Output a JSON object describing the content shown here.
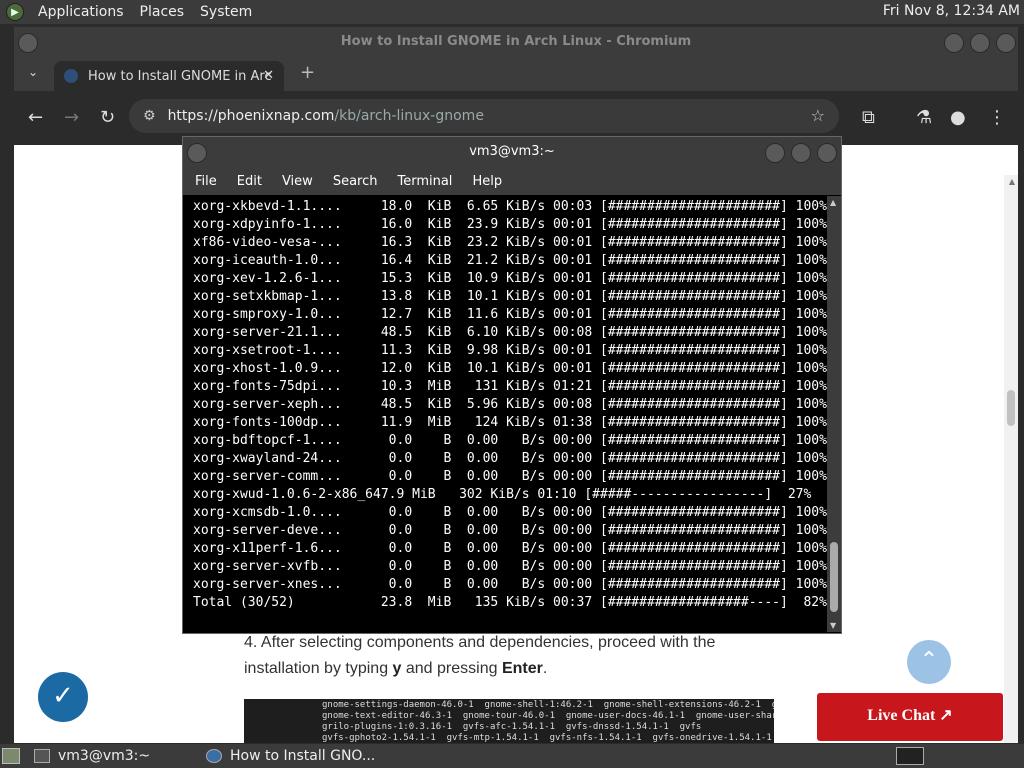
{
  "top_panel": {
    "menus": [
      "Applications",
      "Places",
      "System"
    ],
    "clock": "Fri Nov  8, 12:34 AM"
  },
  "browser": {
    "window_title": "How to Install GNOME in Arch Linux - Chromium",
    "tab_title": "How to Install GNOME in Arc",
    "url_domain": "https://phoenixnap.com",
    "url_path": "/kb/arch-linux-gnome",
    "page": {
      "step_prefix": "4. After selecting components and dependencies, proceed with the installation by typing ",
      "step_key1": "y",
      "step_mid": " and pressing ",
      "step_key2": "Enter",
      "step_end": ".",
      "code_lines": [
        "gnome-settings-daemon-46.0-1  gnome-shell-1:46.2-1  gnome-shell-extensions-46.2-1  gn",
        "gnome-text-editor-46.3-1  gnome-tour-46.0-1  gnome-user-docs-46.1-1  gnome-user-share",
        "grilo-plugins-1:0.3.16-1  gvfs-afc-1.54.1-1  gvfs-dnssd-1.54.1-1  gvfs",
        "gvfs-gphoto2-1.54.1-1  gvfs-mtp-1.54.1-1  gvfs-nfs-1.54.1-1  gvfs-onedrive-1.54.1-1"
      ],
      "live_chat": "Live Chat ↗"
    }
  },
  "terminal": {
    "title": "vm3@vm3:~",
    "menu": [
      "File",
      "Edit",
      "View",
      "Search",
      "Terminal",
      "Help"
    ],
    "lines": [
      "xorg-xkbevd-1.1....     18.0  KiB  6.65 KiB/s 00:03 [######################] 100%",
      "xorg-xdpyinfo-1....     16.0  KiB  23.9 KiB/s 00:01 [######################] 100%",
      "xf86-video-vesa-...     16.3  KiB  23.2 KiB/s 00:01 [######################] 100%",
      "xorg-iceauth-1.0...     16.4  KiB  21.2 KiB/s 00:01 [######################] 100%",
      "xorg-xev-1.2.6-1...     15.3  KiB  10.9 KiB/s 00:01 [######################] 100%",
      "xorg-setxkbmap-1...     13.8  KiB  10.1 KiB/s 00:01 [######################] 100%",
      "xorg-smproxy-1.0...     12.7  KiB  11.6 KiB/s 00:01 [######################] 100%",
      "xorg-server-21.1...     48.5  KiB  6.10 KiB/s 00:08 [######################] 100%",
      "xorg-xsetroot-1....     11.3  KiB  9.98 KiB/s 00:01 [######################] 100%",
      "xorg-xhost-1.0.9...     12.0  KiB  10.1 KiB/s 00:01 [######################] 100%",
      "xorg-fonts-75dpi...     10.3  MiB   131 KiB/s 01:21 [######################] 100%",
      "xorg-server-xeph...     48.5  KiB  5.96 KiB/s 00:08 [######################] 100%",
      "xorg-fonts-100dp...     11.9  MiB   124 KiB/s 01:38 [######################] 100%",
      "xorg-bdftopcf-1....      0.0    B  0.00   B/s 00:00 [######################] 100%",
      "xorg-xwayland-24...      0.0    B  0.00   B/s 00:00 [######################] 100%",
      "xorg-server-comm...      0.0    B  0.00   B/s 00:00 [######################] 100%",
      "xorg-xwud-1.0.6-2-x86_647.9 MiB   302 KiB/s 01:10 [#####-----------------]  27%",
      "xorg-xcmsdb-1.0....      0.0    B  0.00   B/s 00:00 [######################] 100%",
      "xorg-server-deve...      0.0    B  0.00   B/s 00:00 [######################] 100%",
      "xorg-x11perf-1.6...      0.0    B  0.00   B/s 00:00 [######################] 100%",
      "xorg-server-xvfb...      0.0    B  0.00   B/s 00:00 [######################] 100%",
      "xorg-server-xnes...      0.0    B  0.00   B/s 00:00 [######################] 100%",
      "Total (30/52)           23.8  MiB   135 KiB/s 00:37 [##################----]  82%"
    ]
  },
  "taskbar": {
    "items": [
      "vm3@vm3:~",
      "How to Install GNO..."
    ]
  }
}
